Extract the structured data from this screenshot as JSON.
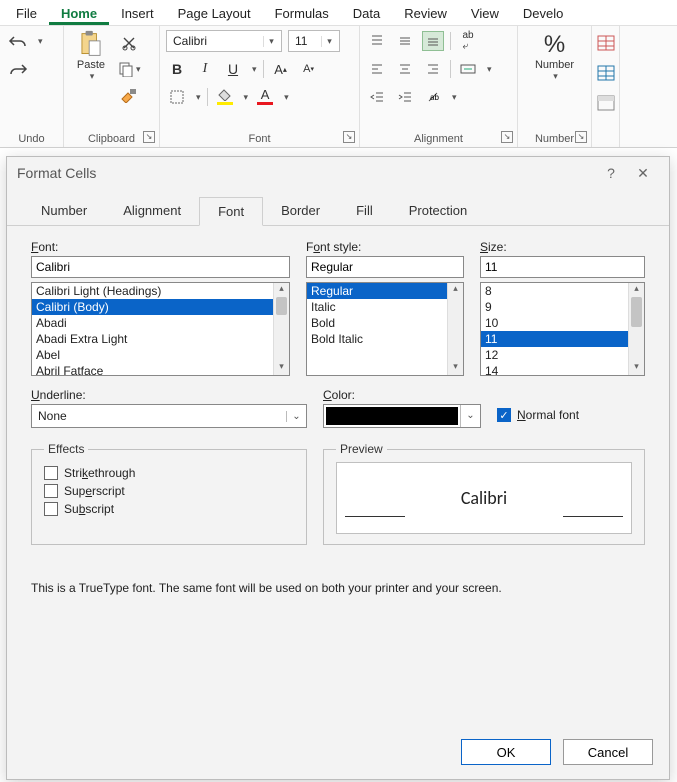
{
  "menubar": {
    "items": [
      "File",
      "Home",
      "Insert",
      "Page Layout",
      "Formulas",
      "Data",
      "Review",
      "View",
      "Develo"
    ],
    "active": "Home"
  },
  "ribbon": {
    "undo": {
      "label": "Undo"
    },
    "clipboard": {
      "label": "Clipboard",
      "paste": "Paste"
    },
    "font": {
      "label": "Font",
      "name": "Calibri",
      "size": "11",
      "bold": "B",
      "italic": "I",
      "underline": "U"
    },
    "alignment": {
      "label": "Alignment"
    },
    "number": {
      "label": "Number",
      "big": "Number"
    }
  },
  "dialog": {
    "title": "Format Cells",
    "tabs": [
      "Number",
      "Alignment",
      "Font",
      "Border",
      "Fill",
      "Protection"
    ],
    "activeTab": "Font",
    "fontLabel": "Font:",
    "fontValue": "Calibri",
    "fontList": [
      "Calibri Light (Headings)",
      "Calibri (Body)",
      "Abadi",
      "Abadi Extra Light",
      "Abel",
      "Abril Fatface"
    ],
    "fontSelected": "Calibri (Body)",
    "styleLabel": "Font style:",
    "styleValue": "Regular",
    "styleList": [
      "Regular",
      "Italic",
      "Bold",
      "Bold Italic"
    ],
    "styleSelected": "Regular",
    "sizeLabel": "Size:",
    "sizeValue": "11",
    "sizeList": [
      "8",
      "9",
      "10",
      "11",
      "12",
      "14"
    ],
    "sizeSelected": "11",
    "underlineLabel": "Underline:",
    "underlineValue": "None",
    "colorLabel": "Color:",
    "colorValue": "#000000",
    "normalFontLabel": "Normal font",
    "normalFontChecked": true,
    "effectsLabel": "Effects",
    "strike": "Strikethrough",
    "superscript": "Superscript",
    "subscript": "Subscript",
    "previewLabel": "Preview",
    "previewText": "Calibri",
    "desc": "This is a TrueType font.  The same font will be used on both your printer and your screen.",
    "ok": "OK",
    "cancel": "Cancel",
    "help": "?",
    "close": "✕"
  }
}
